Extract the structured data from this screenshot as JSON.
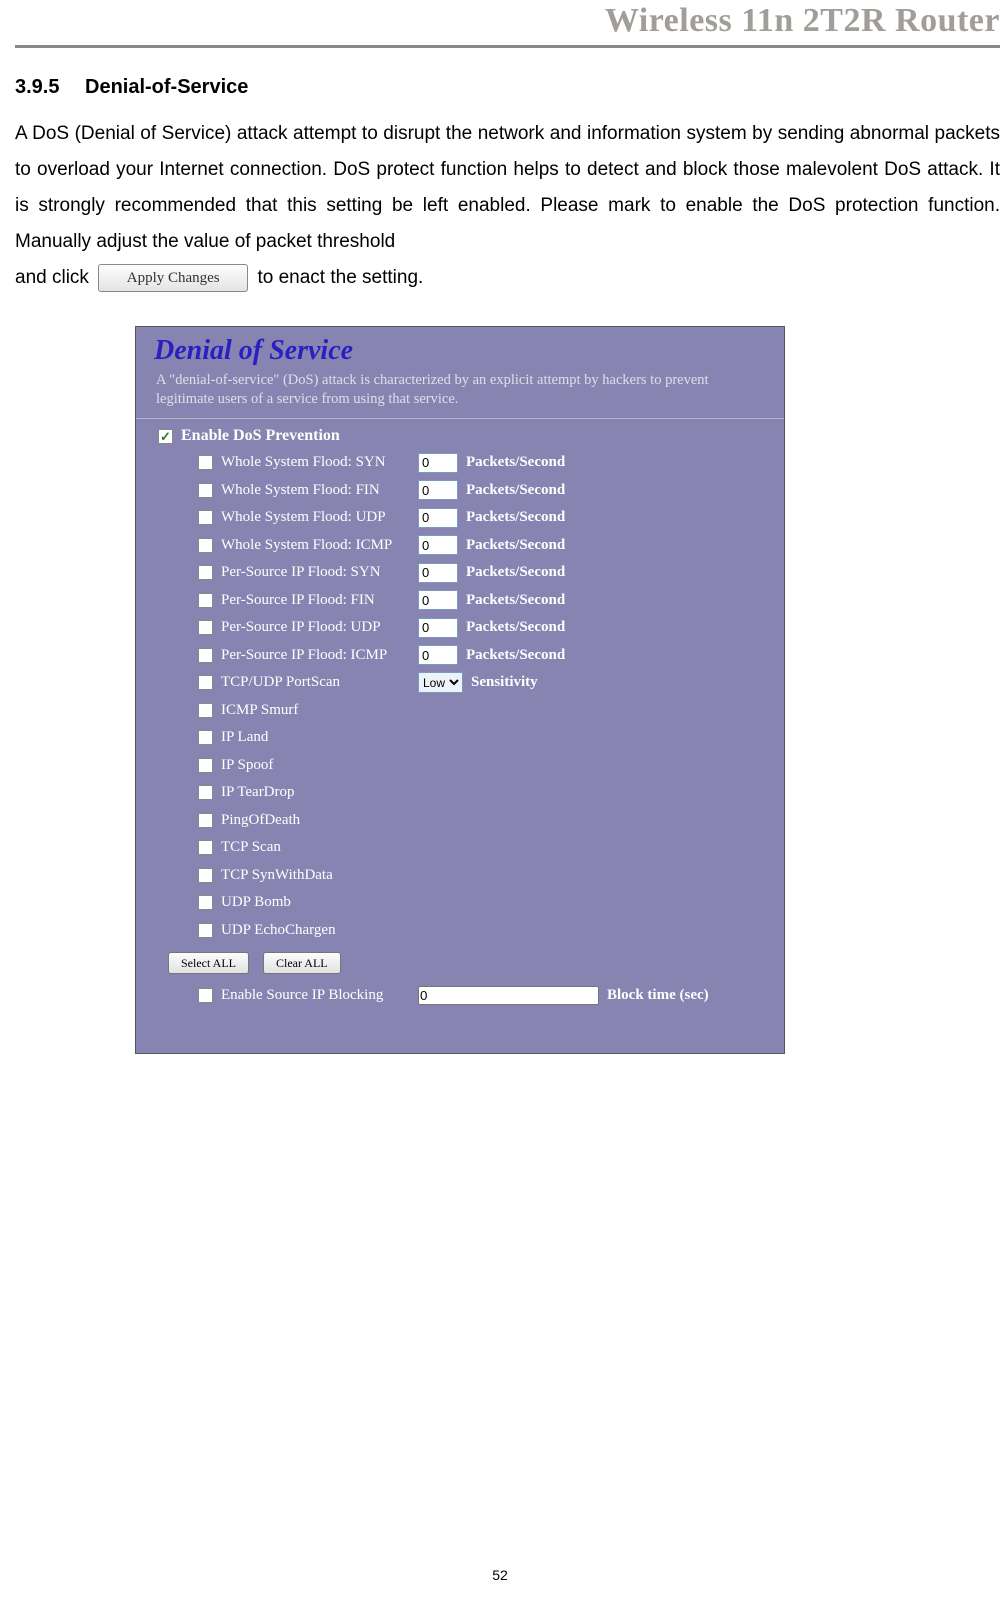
{
  "header": {
    "title": "Wireless 11n 2T2R Router"
  },
  "section": {
    "number": "3.9.5",
    "title": "Denial-of-Service"
  },
  "body": {
    "p1a": "A DoS (Denial of Service) attack attempt to disrupt the network and information system by sending abnormal packets to overload your Internet connection. DoS protect function helps to detect and block those malevolent DoS attack. It is strongly recommended that this setting be left enabled. Please mark to enable the DoS protection function. Manually adjust the value of packet threshold",
    "p1b_prefix": "and click ",
    "apply_btn": "Apply Changes",
    "p1b_suffix": " to enact the setting."
  },
  "panel": {
    "title": "Denial of Service",
    "description": "A \"denial-of-service\" (DoS) attack is characterized by an explicit attempt by hackers to prevent legitimate users of a service from using that service.",
    "enable_label": "Enable DoS Prevention",
    "enable_checked": true,
    "options": [
      {
        "label": "Whole System Flood: SYN",
        "value": "0",
        "unit": "Packets/Second"
      },
      {
        "label": "Whole System Flood: FIN",
        "value": "0",
        "unit": "Packets/Second"
      },
      {
        "label": "Whole System Flood: UDP",
        "value": "0",
        "unit": "Packets/Second"
      },
      {
        "label": "Whole System Flood: ICMP",
        "value": "0",
        "unit": "Packets/Second"
      },
      {
        "label": "Per-Source IP Flood: SYN",
        "value": "0",
        "unit": "Packets/Second"
      },
      {
        "label": "Per-Source IP Flood: FIN",
        "value": "0",
        "unit": "Packets/Second"
      },
      {
        "label": "Per-Source IP Flood: UDP",
        "value": "0",
        "unit": "Packets/Second"
      },
      {
        "label": "Per-Source IP Flood: ICMP",
        "value": "0",
        "unit": "Packets/Second"
      },
      {
        "label": "TCP/UDP PortScan",
        "select": "Low",
        "unit": "Sensitivity"
      },
      {
        "label": "ICMP Smurf"
      },
      {
        "label": "IP Land"
      },
      {
        "label": "IP Spoof"
      },
      {
        "label": "IP TearDrop"
      },
      {
        "label": "PingOfDeath"
      },
      {
        "label": "TCP Scan"
      },
      {
        "label": "TCP SynWithData"
      },
      {
        "label": "UDP Bomb"
      },
      {
        "label": "UDP EchoChargen"
      }
    ],
    "buttons": {
      "select_all": "Select ALL",
      "clear_all": "Clear ALL"
    },
    "block": {
      "label": "Enable Source IP Blocking",
      "value": "0",
      "unit": "Block time (sec)"
    }
  },
  "page_number": "52"
}
